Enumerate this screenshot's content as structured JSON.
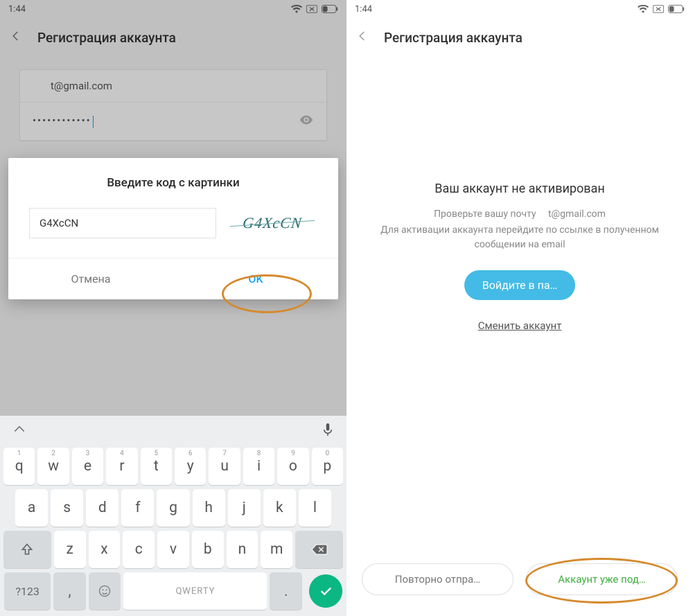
{
  "status": {
    "time": "1:44"
  },
  "left": {
    "title": "Регистрация аккаунта",
    "email": "t@gmail.com",
    "password_masked": "••••••••••••",
    "dialog": {
      "title": "Введите код с картинки",
      "input_value": "G4XcCN",
      "captcha_text": "G4XcCN",
      "cancel": "Отмена",
      "ok": "OK"
    },
    "keyboard": {
      "numbers": [
        "1",
        "2",
        "3",
        "4",
        "5",
        "6",
        "7",
        "8",
        "9",
        "0"
      ],
      "row1": [
        "q",
        "w",
        "e",
        "r",
        "t",
        "y",
        "u",
        "i",
        "o",
        "p"
      ],
      "row2": [
        "a",
        "s",
        "d",
        "f",
        "g",
        "h",
        "j",
        "k",
        "l"
      ],
      "row3": [
        "z",
        "x",
        "c",
        "v",
        "b",
        "n",
        "m"
      ],
      "fn123": "?123",
      "space": "QWERTY"
    }
  },
  "right": {
    "title": "Регистрация аккаунта",
    "heading": "Ваш аккаунт не активирован",
    "line1_a": "Проверьте вашу почту",
    "line1_b": "t@gmail.com",
    "line2": "Для активации аккаунта перейдите по ссылке в полученном сообщении на email",
    "login_btn": "Войдите в па…",
    "switch_link": "Сменить аккаунт",
    "resend_btn": "Повторно отпра…",
    "confirmed_btn": "Аккаунт уже под…"
  }
}
